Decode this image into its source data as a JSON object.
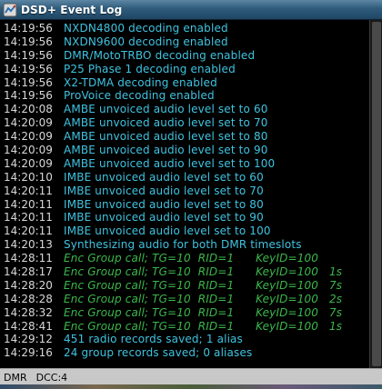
{
  "window": {
    "title": "DSD+ Event Log",
    "icon": "dsd-app-icon"
  },
  "log": [
    {
      "time": "14:19:56",
      "message": "NXDN4800 decoding enabled",
      "kind": "info"
    },
    {
      "time": "14:19:56",
      "message": "NXDN9600 decoding enabled",
      "kind": "info"
    },
    {
      "time": "14:19:56",
      "message": "DMR/MotoTRBO decoding enabled",
      "kind": "info"
    },
    {
      "time": "14:19:56",
      "message": "P25 Phase 1 decoding enabled",
      "kind": "info"
    },
    {
      "time": "14:19:56",
      "message": "X2-TDMA decoding enabled",
      "kind": "info"
    },
    {
      "time": "14:19:56",
      "message": "ProVoice decoding enabled",
      "kind": "info"
    },
    {
      "time": "14:20:08",
      "message": "AMBE unvoiced audio level set to 60",
      "kind": "info"
    },
    {
      "time": "14:20:09",
      "message": "AMBE unvoiced audio level set to 70",
      "kind": "info"
    },
    {
      "time": "14:20:09",
      "message": "AMBE unvoiced audio level set to 80",
      "kind": "info"
    },
    {
      "time": "14:20:09",
      "message": "AMBE unvoiced audio level set to 90",
      "kind": "info"
    },
    {
      "time": "14:20:09",
      "message": "AMBE unvoiced audio level set to 100",
      "kind": "info"
    },
    {
      "time": "14:20:10",
      "message": "IMBE unvoiced audio level set to 60",
      "kind": "info"
    },
    {
      "time": "14:20:11",
      "message": "IMBE unvoiced audio level set to 70",
      "kind": "info"
    },
    {
      "time": "14:20:11",
      "message": "IMBE unvoiced audio level set to 80",
      "kind": "info"
    },
    {
      "time": "14:20:11",
      "message": "IMBE unvoiced audio level set to 90",
      "kind": "info"
    },
    {
      "time": "14:20:11",
      "message": "IMBE unvoiced audio level set to 100",
      "kind": "info"
    },
    {
      "time": "14:20:13",
      "message": "Synthesizing audio for both DMR timeslots",
      "kind": "info"
    },
    {
      "time": "14:28:11",
      "message": "Enc Group call; TG=10  RID=1      KeyID=100",
      "kind": "call"
    },
    {
      "time": "14:28:17",
      "message": "Enc Group call; TG=10  RID=1      KeyID=100   1s",
      "kind": "call"
    },
    {
      "time": "14:28:20",
      "message": "Enc Group call; TG=10  RID=1      KeyID=100   7s",
      "kind": "call"
    },
    {
      "time": "14:28:28",
      "message": "Enc Group call; TG=10  RID=1      KeyID=100   2s",
      "kind": "call"
    },
    {
      "time": "14:28:32",
      "message": "Enc Group call; TG=10  RID=1      KeyID=100   7s",
      "kind": "call"
    },
    {
      "time": "14:28:41",
      "message": "Enc Group call; TG=10  RID=1      KeyID=100   1s",
      "kind": "call"
    },
    {
      "time": "14:29:12",
      "message": "451 radio records saved; 1 alias",
      "kind": "save"
    },
    {
      "time": "14:29:16",
      "message": "24 group records saved; 0 aliases",
      "kind": "save"
    }
  ],
  "status": {
    "mode": "DMR",
    "dcc": "DCC:4"
  },
  "colors": {
    "info": "#3fc3e0",
    "call": "#3bb84a",
    "timestamp": "#d8d8d8",
    "background": "#000000"
  }
}
